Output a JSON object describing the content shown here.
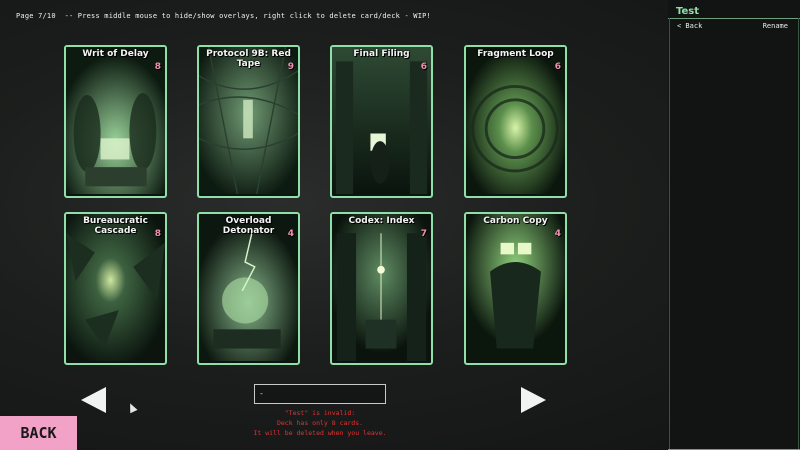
{
  "header": {
    "page_indicator": "Page 7/10",
    "hint": "  -- Press middle mouse to hide/show overlays, right click to delete card/deck - WIP!"
  },
  "cards": [
    {
      "name": "Writ of Delay",
      "cost": "8"
    },
    {
      "name": "Protocol 9B: Red Tape",
      "cost": "9"
    },
    {
      "name": "Final Filing",
      "cost": "6"
    },
    {
      "name": "Fragment Loop",
      "cost": "6"
    },
    {
      "name": "Bureaucratic Cascade",
      "cost": "8"
    },
    {
      "name": "Overload Detonator",
      "cost": "4"
    },
    {
      "name": "Codex: Index",
      "cost": "7"
    },
    {
      "name": "Carbon Copy",
      "cost": "4"
    }
  ],
  "search": {
    "value": "-"
  },
  "warning": {
    "line1": "\"Test\" is invalid:",
    "line2": "Deck has only 8 cards.",
    "line3": "It will be deleted when you leave."
  },
  "back_button": {
    "label": "BACK"
  },
  "deck_panel": {
    "title": "Test",
    "back_label": "< Back",
    "rename_label": "Rename"
  },
  "colors": {
    "card_border": "#8fe0a8",
    "cost_text": "#f28fb0",
    "warning_text": "#e33333",
    "back_button_bg": "#f2a2c7",
    "accent": "#8fe0a8"
  }
}
